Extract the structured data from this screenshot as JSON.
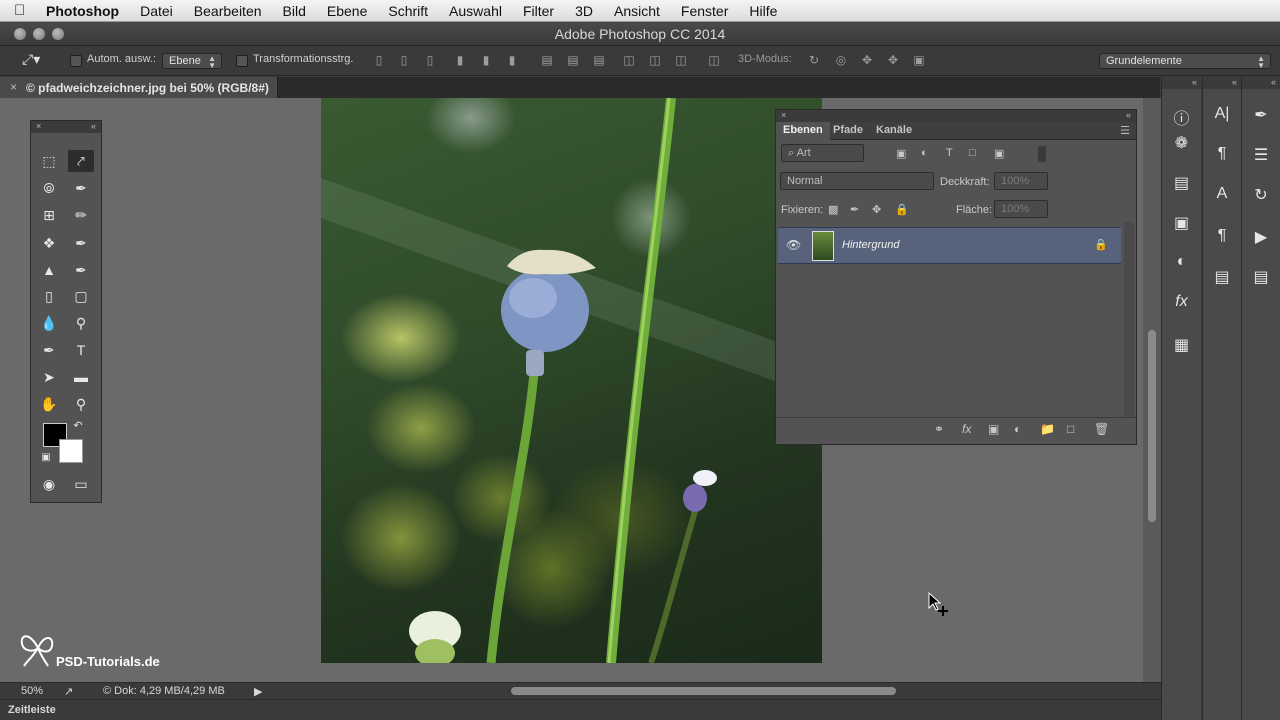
{
  "menubar": {
    "apple_icon": "apple-icon",
    "items": [
      "Photoshop",
      "Datei",
      "Bearbeiten",
      "Bild",
      "Ebene",
      "Schrift",
      "Auswahl",
      "Filter",
      "3D",
      "Ansicht",
      "Fenster",
      "Hilfe"
    ]
  },
  "window": {
    "title": "Adobe Photoshop CC 2014"
  },
  "options": {
    "auto_select_label": "Autom. ausw.:",
    "auto_select_value": "Ebene",
    "transform_label": "Transformationsstrg.",
    "mode_3d_label": "3D-Modus:",
    "workspace_value": "Grundelemente"
  },
  "document": {
    "tab_label": "© pfadweichzeichner.jpg bei 50% (RGB/8#)"
  },
  "layers_panel": {
    "tabs": [
      "Ebenen",
      "Pfade",
      "Kanäle"
    ],
    "filter_value": "Art",
    "blend_mode": "Normal",
    "opacity_label": "Deckkraft:",
    "opacity_value": "100%",
    "lock_label": "Fixieren:",
    "fill_label": "Fläche:",
    "fill_value": "100%",
    "layer_name": "Hintergrund"
  },
  "status": {
    "zoom": "50%",
    "doc_info": "© Dok: 4,29 MB/4,29 MB"
  },
  "timeline_label": "Zeitleiste",
  "watermark": "PSD-Tutorials.de",
  "colors": {
    "menubar": "#e6e6e6",
    "workspace": "#6a6a6a",
    "panel": "#535353",
    "layer_selected": "#56637a",
    "foreground": "#000000",
    "background": "#ffffff"
  }
}
